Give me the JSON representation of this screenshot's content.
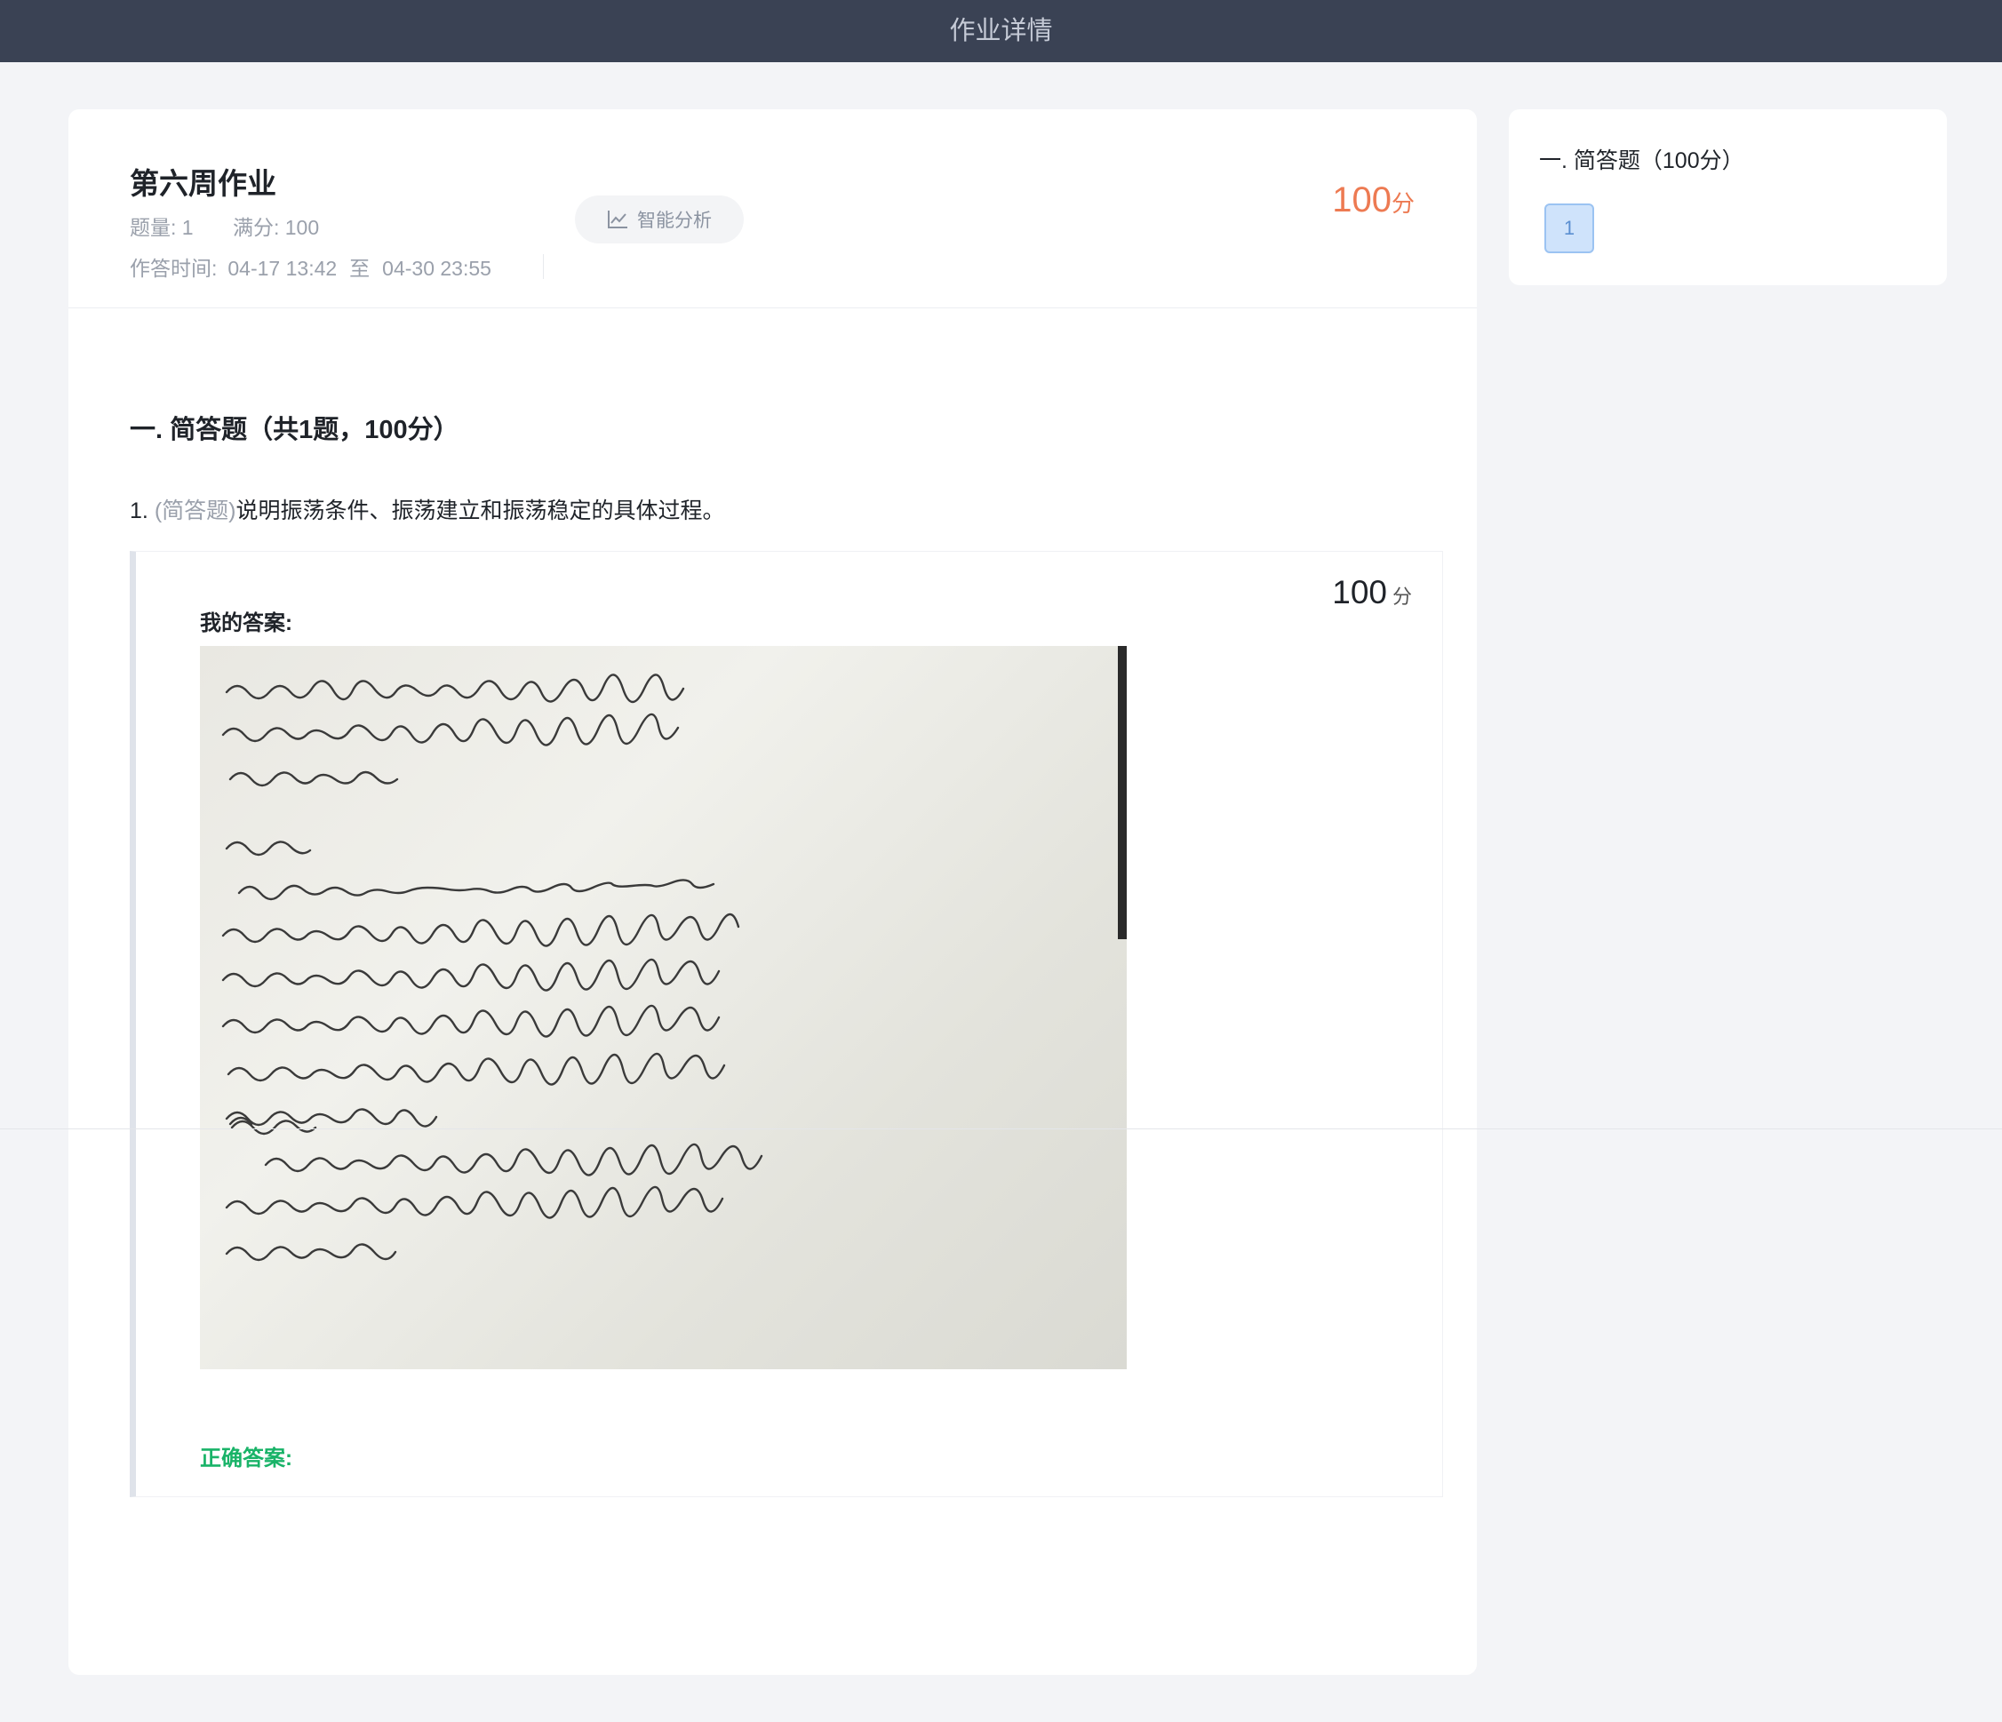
{
  "topbar": {
    "title": "作业详情"
  },
  "header": {
    "title": "第六周作业",
    "question_count": "题量: 1",
    "full_score": "满分: 100",
    "time_label": "作答时间:",
    "time_start": "04-17 13:42",
    "time_sep": "至",
    "time_end": "04-30 23:55",
    "analysis_button": "智能分析",
    "analysis_icon": "line-chart-icon",
    "score": "100",
    "score_unit": "分"
  },
  "section": {
    "title": "一. 简答题（共1题，100分）"
  },
  "question": {
    "number": "1.",
    "type": "(简答题)",
    "text": "说明振荡条件、振荡建立和振荡稳定的具体过程。",
    "score": "100",
    "score_unit": "分",
    "my_answer_label": "我的答案:",
    "correct_answer_label": "正确答案:"
  },
  "sidebar": {
    "section_title": "一. 简答题（100分）",
    "question_numbers": [
      "1"
    ]
  },
  "colors": {
    "topbar_bg": "#3a4254",
    "score_accent": "#ed7a52",
    "correct_green": "#19b368",
    "active_qnum_bg": "#cfe3fb"
  }
}
